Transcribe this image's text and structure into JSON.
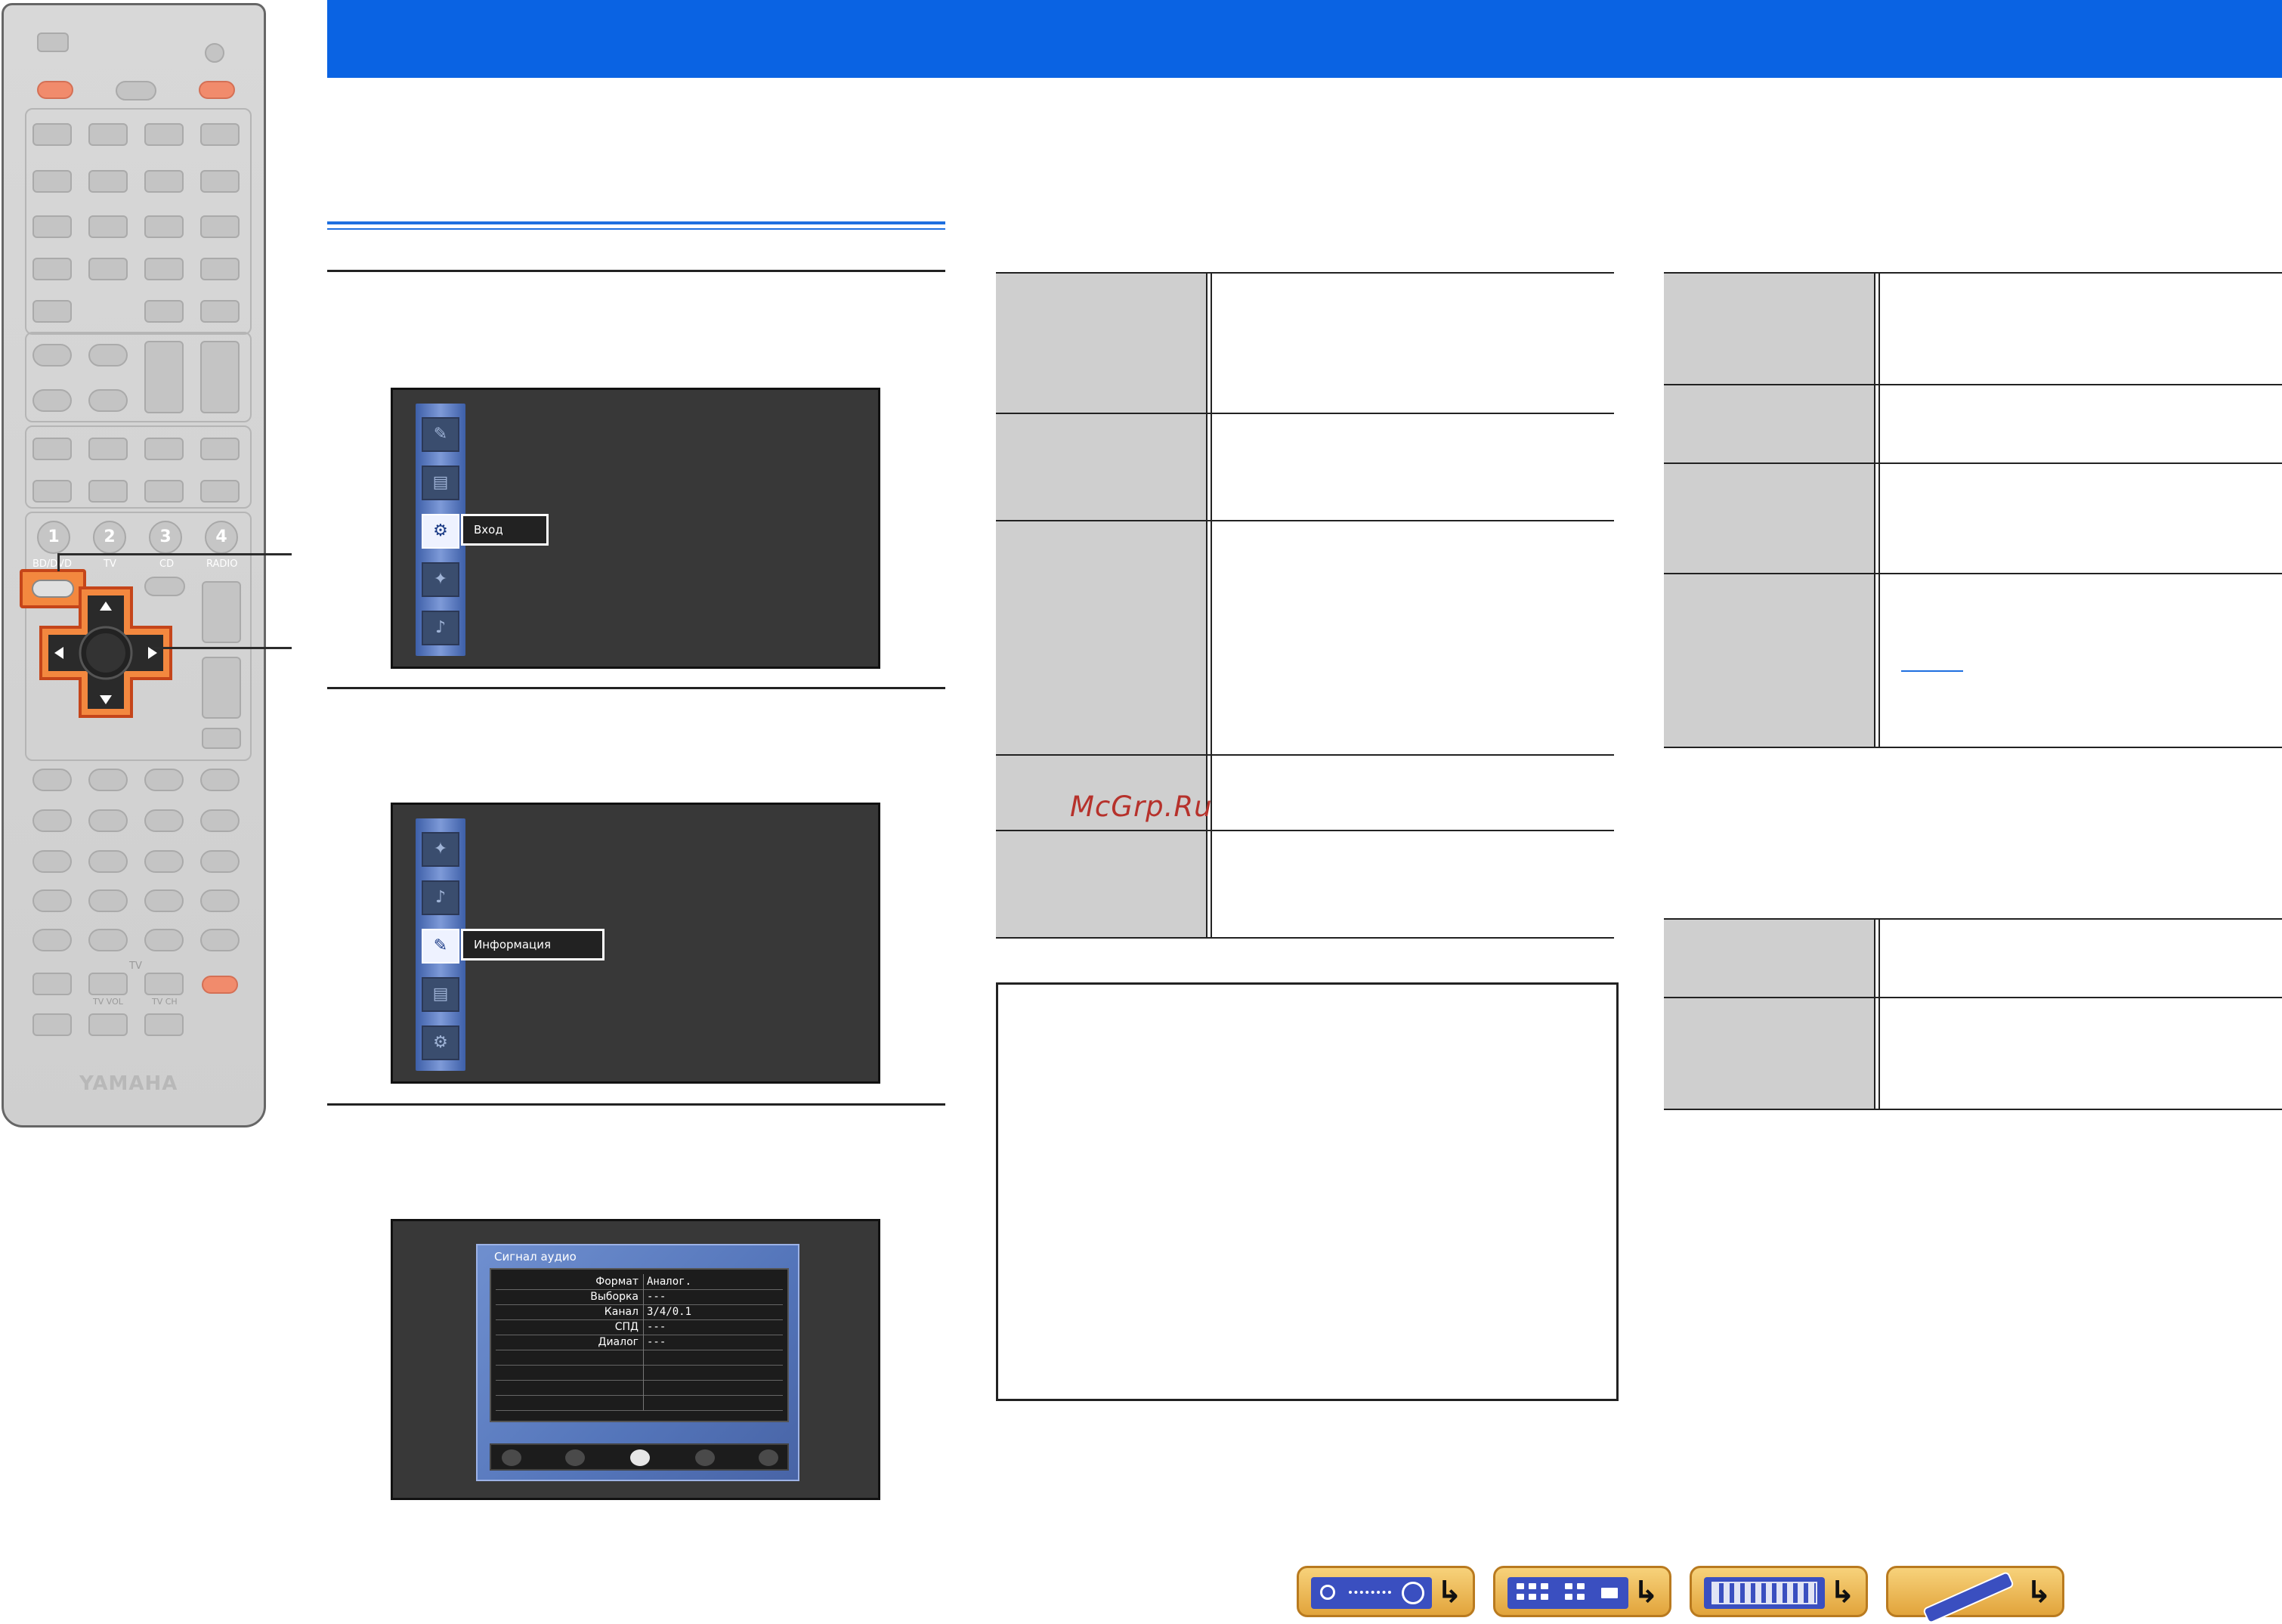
{
  "remote": {
    "brand": "YAMAHA",
    "number_keys": [
      "1",
      "2",
      "3",
      "4"
    ],
    "source_labels": [
      "BD/DVD",
      "TV",
      "CD",
      "RADIO"
    ],
    "tv_label": "TV",
    "tv_vol_label": "TV VOL",
    "tv_ch_label": "TV CH",
    "highlight_color": "#f3883f"
  },
  "screen1": {
    "selected_item": "Вход"
  },
  "screen2": {
    "selected_item": "Информация"
  },
  "screen3": {
    "title": "Сигнал аудио",
    "rows": [
      {
        "key": "Формат",
        "value": "Аналог."
      },
      {
        "key": "Выборка",
        "value": "---"
      },
      {
        "key": "Канал",
        "value": "3/4/0.1"
      },
      {
        "key": "СПД",
        "value": "---"
      },
      {
        "key": "Диалог",
        "value": "---"
      }
    ]
  },
  "watermark": "McGrp.Ru",
  "colors": {
    "header_blue": "#0a63e3",
    "table_label_gray": "#cfcfcf",
    "nav_button_gold": "#e2a43b"
  }
}
